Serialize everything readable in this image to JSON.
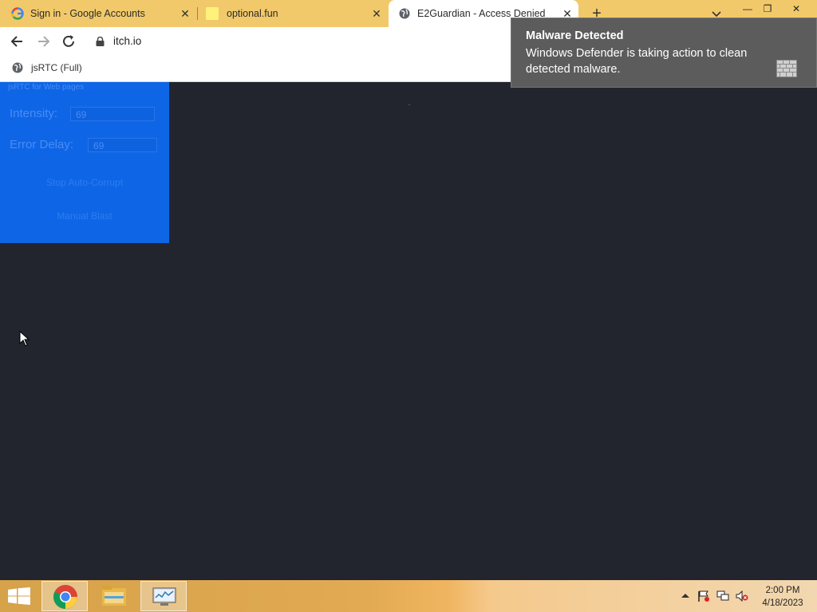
{
  "tabs": [
    {
      "title": "Sign in - Google Accounts",
      "icon": "google-icon",
      "active": false
    },
    {
      "title": "optional.fun",
      "icon": "yellow-square-icon",
      "active": false
    },
    {
      "title": "E2Guardian - Access Denied",
      "icon": "globe-icon",
      "active": true
    }
  ],
  "window_controls": {
    "minimize": "—",
    "restore": "❐",
    "close": "✕"
  },
  "toolbar": {
    "url": "itch.io"
  },
  "bookmarks": [
    {
      "label": "jsRTC (Full)",
      "icon": "globe-icon"
    }
  ],
  "panel": {
    "subtitle": "jsRTC for Web pages",
    "intensity_label": "Intensity:",
    "intensity_value": "69",
    "error_delay_label": "Error Delay:",
    "error_delay_value": "69",
    "stop_button": "Stop Auto-Corrupt",
    "manual_button": "Manual Blast"
  },
  "toast": {
    "title": "Malware Detected",
    "body": "Windows Defender is taking action to clean detected malware."
  },
  "taskbar": {
    "apps": [
      "chrome-icon",
      "file-explorer-icon",
      "resource-monitor-icon"
    ],
    "time": "2:00 PM",
    "date": "4/18/2023"
  },
  "colors": {
    "tabstrip": "#f2c96a",
    "panel": "#0e66e6",
    "page_bg": "#22252e",
    "toast_bg": "#5c5c5c"
  }
}
